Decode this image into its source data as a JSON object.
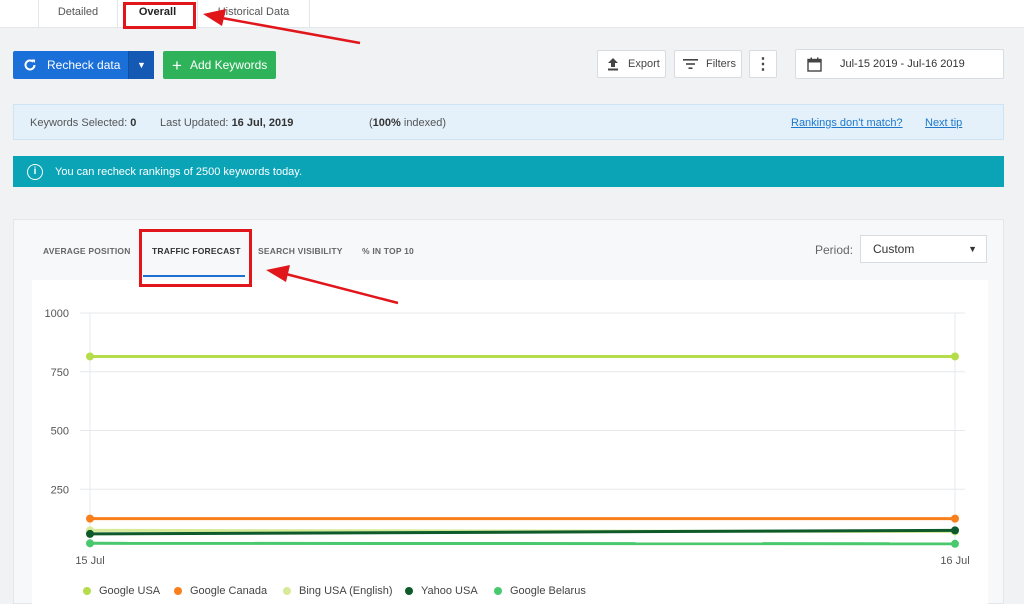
{
  "tabs": {
    "detailed": "Detailed",
    "overall": "Overall",
    "historical": "Historical Data"
  },
  "toolbar": {
    "recheck_label": "Recheck data",
    "add_label": "Add Keywords",
    "export_label": "Export",
    "filters_label": "Filters",
    "date_range": "Jul-15 2019 - Jul-16 2019"
  },
  "info": {
    "selected_label": "Keywords Selected:",
    "selected_value": "0",
    "updated_label": "Last Updated:",
    "updated_value": "16 Jul, 2019",
    "indexed_open": "(",
    "indexed_value": "100%",
    "indexed_rest": " indexed)",
    "mismatch_link": "Rankings don't match?",
    "tip_link": "Next tip"
  },
  "notice": {
    "text": "You can recheck rankings of 2500 keywords today."
  },
  "metric_tabs": [
    "AVERAGE POSITION",
    "TRAFFIC FORECAST",
    "SEARCH VISIBILITY",
    "% IN TOP 10"
  ],
  "period": {
    "label": "Period:",
    "value": "Custom"
  },
  "colors": {
    "primary": "#1a6fd8",
    "success": "#2eb35a",
    "teal": "#0aa4b6",
    "highlight": "#e0161b"
  },
  "chart_data": {
    "type": "line",
    "x": [
      "15 Jul",
      "16 Jul"
    ],
    "ylim": [
      0,
      1000
    ],
    "yticks": [
      250,
      500,
      750,
      1000
    ],
    "grid": true,
    "legend_position": "bottom",
    "series": [
      {
        "name": "Google USA",
        "color": "#b5dc4a",
        "values": [
          815,
          815
        ]
      },
      {
        "name": "Google Canada",
        "color": "#f97f1b",
        "values": [
          125,
          125
        ]
      },
      {
        "name": "Bing USA (English)",
        "color": "#d6ea9a",
        "values": [
          75,
          70
        ]
      },
      {
        "name": "Yahoo USA",
        "color": "#0e5a2a",
        "values": [
          60,
          75
        ]
      },
      {
        "name": "Google Belarus",
        "color": "#49c86e",
        "values": [
          20,
          18
        ]
      }
    ]
  }
}
